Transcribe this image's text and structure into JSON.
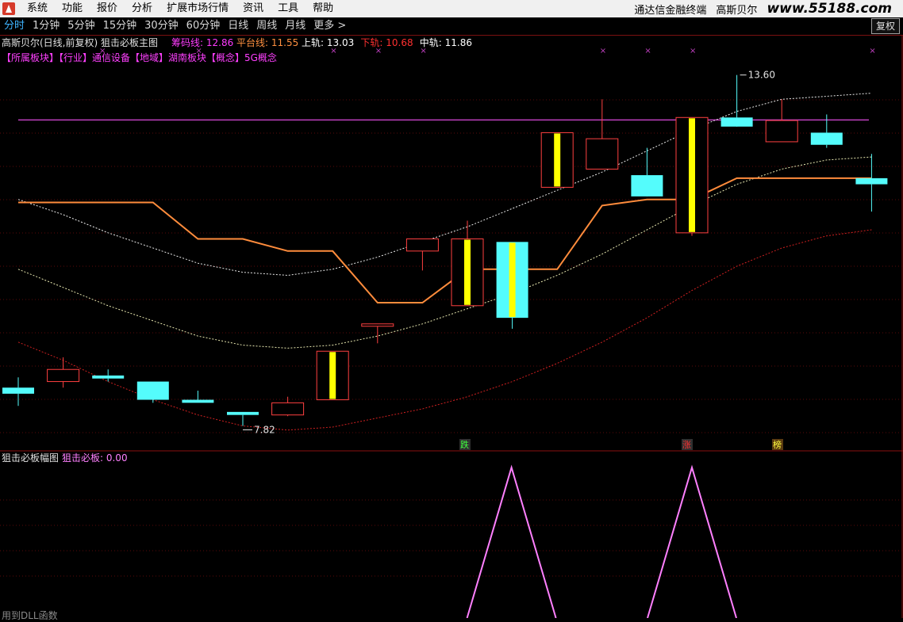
{
  "menubar": {
    "items": [
      "系统",
      "功能",
      "报价",
      "分析",
      "扩展市场行情",
      "资讯",
      "工具",
      "帮助"
    ],
    "right_title": "通达信金融终端",
    "right_stock": "高斯贝尔",
    "watermark": "www.55188.com"
  },
  "periods": {
    "items": [
      "分时",
      "1分钟",
      "5分钟",
      "15分钟",
      "30分钟",
      "60分钟",
      "日线",
      "周线",
      "月线",
      "更多 >"
    ],
    "active_index": 0
  },
  "fuquan_button": "复权",
  "main_chart": {
    "title": "高斯贝尔(日线,前复权) 狙击必板主图",
    "indicators": [
      {
        "label": "筹码线: 12.86",
        "color": "#ff3cff"
      },
      {
        "label": "平台线: 11.55",
        "color": "#ff9040"
      },
      {
        "label": "上轨: 13.03",
        "color": "#ffffff"
      },
      {
        "label": "下轨: 10.68",
        "color": "#ff3030"
      },
      {
        "label": "中轨: 11.86",
        "color": "#ffffff"
      }
    ],
    "sector_line": "【所属板块】【行业】通信设备【地域】湖南板块【概念】5G概念",
    "high_label": "13.60",
    "low_label": "7.82",
    "signals": [
      {
        "text": "跌",
        "color": "#40ff40",
        "bg": "#303030"
      },
      {
        "text": "涨",
        "color": "#ff3030",
        "bg": "#303030"
      },
      {
        "text": "榜",
        "color": "#ffff40",
        "bg": "#5a3a10"
      }
    ]
  },
  "chart_data": {
    "type": "candlestick",
    "price_range": [
      7.5,
      14.0
    ],
    "candles": [
      {
        "o": 8.45,
        "h": 8.62,
        "l": 8.15,
        "c": 8.35
      },
      {
        "o": 8.55,
        "h": 8.95,
        "l": 8.45,
        "c": 8.75
      },
      {
        "o": 8.65,
        "h": 8.75,
        "l": 8.55,
        "c": 8.6
      },
      {
        "o": 8.55,
        "h": 8.55,
        "l": 8.2,
        "c": 8.25
      },
      {
        "o": 8.25,
        "h": 8.4,
        "l": 8.2,
        "c": 8.2
      },
      {
        "o": 8.05,
        "h": 8.05,
        "l": 7.82,
        "c": 8.0
      },
      {
        "o": 8.0,
        "h": 8.3,
        "l": 7.98,
        "c": 8.2
      },
      {
        "o": 8.25,
        "h": 9.05,
        "l": 8.25,
        "c": 9.05
      },
      {
        "o": 9.5,
        "h": 9.5,
        "l": 9.18,
        "c": 9.5
      },
      {
        "o": 10.7,
        "h": 10.9,
        "l": 10.38,
        "c": 10.9
      },
      {
        "o": 9.8,
        "h": 11.2,
        "l": 9.8,
        "c": 10.9
      },
      {
        "o": 10.85,
        "h": 10.85,
        "l": 9.42,
        "c": 9.6
      },
      {
        "o": 11.75,
        "h": 12.65,
        "l": 11.75,
        "c": 12.65
      },
      {
        "o": 12.05,
        "h": 13.2,
        "l": 12.05,
        "c": 12.55
      },
      {
        "o": 11.95,
        "h": 12.4,
        "l": 11.7,
        "c": 11.6
      },
      {
        "o": 11.0,
        "h": 12.9,
        "l": 10.95,
        "c": 12.9
      },
      {
        "o": 12.9,
        "h": 13.6,
        "l": 12.9,
        "c": 12.75
      },
      {
        "o": 12.5,
        "h": 13.2,
        "l": 12.5,
        "c": 12.85
      },
      {
        "o": 12.65,
        "h": 12.95,
        "l": 12.4,
        "c": 12.45
      },
      {
        "o": 11.9,
        "h": 12.3,
        "l": 11.35,
        "c": 11.8
      }
    ],
    "platform_line": [
      11.5,
      11.5,
      11.5,
      11.5,
      10.9,
      10.9,
      10.7,
      10.7,
      9.85,
      9.85,
      10.4,
      10.4,
      10.4,
      11.45,
      11.55,
      11.55,
      11.9,
      11.9,
      11.9,
      11.9
    ],
    "upper_band": [
      11.55,
      11.3,
      11.0,
      10.75,
      10.5,
      10.35,
      10.3,
      10.4,
      10.6,
      10.85,
      11.1,
      11.4,
      11.7,
      12.0,
      12.35,
      12.7,
      13.0,
      13.2,
      13.25,
      13.3
    ],
    "middle_band": [
      10.4,
      10.1,
      9.8,
      9.55,
      9.3,
      9.15,
      9.1,
      9.15,
      9.3,
      9.5,
      9.75,
      10.0,
      10.3,
      10.65,
      11.05,
      11.45,
      11.8,
      12.05,
      12.2,
      12.25
    ],
    "lower_band": [
      9.2,
      8.9,
      8.55,
      8.25,
      8.0,
      7.82,
      7.75,
      7.8,
      7.95,
      8.1,
      8.3,
      8.55,
      8.85,
      9.2,
      9.6,
      10.05,
      10.45,
      10.75,
      10.95,
      11.05
    ],
    "chip_line": 12.86
  },
  "sub_chart": {
    "title": "狙击必板幅图",
    "value_label": "狙击必板: 0.00",
    "peaks": [
      11,
      15
    ]
  },
  "bottom_text": "用到DLL函数",
  "colors": {
    "bull": "#ff4040",
    "bear": "#54fcfc",
    "yellow_bar": "#ffff00",
    "platform": "#ff8c3c",
    "chip": "#c040c0",
    "sub_line": "#ff80ff",
    "grid": "#8a1010"
  }
}
